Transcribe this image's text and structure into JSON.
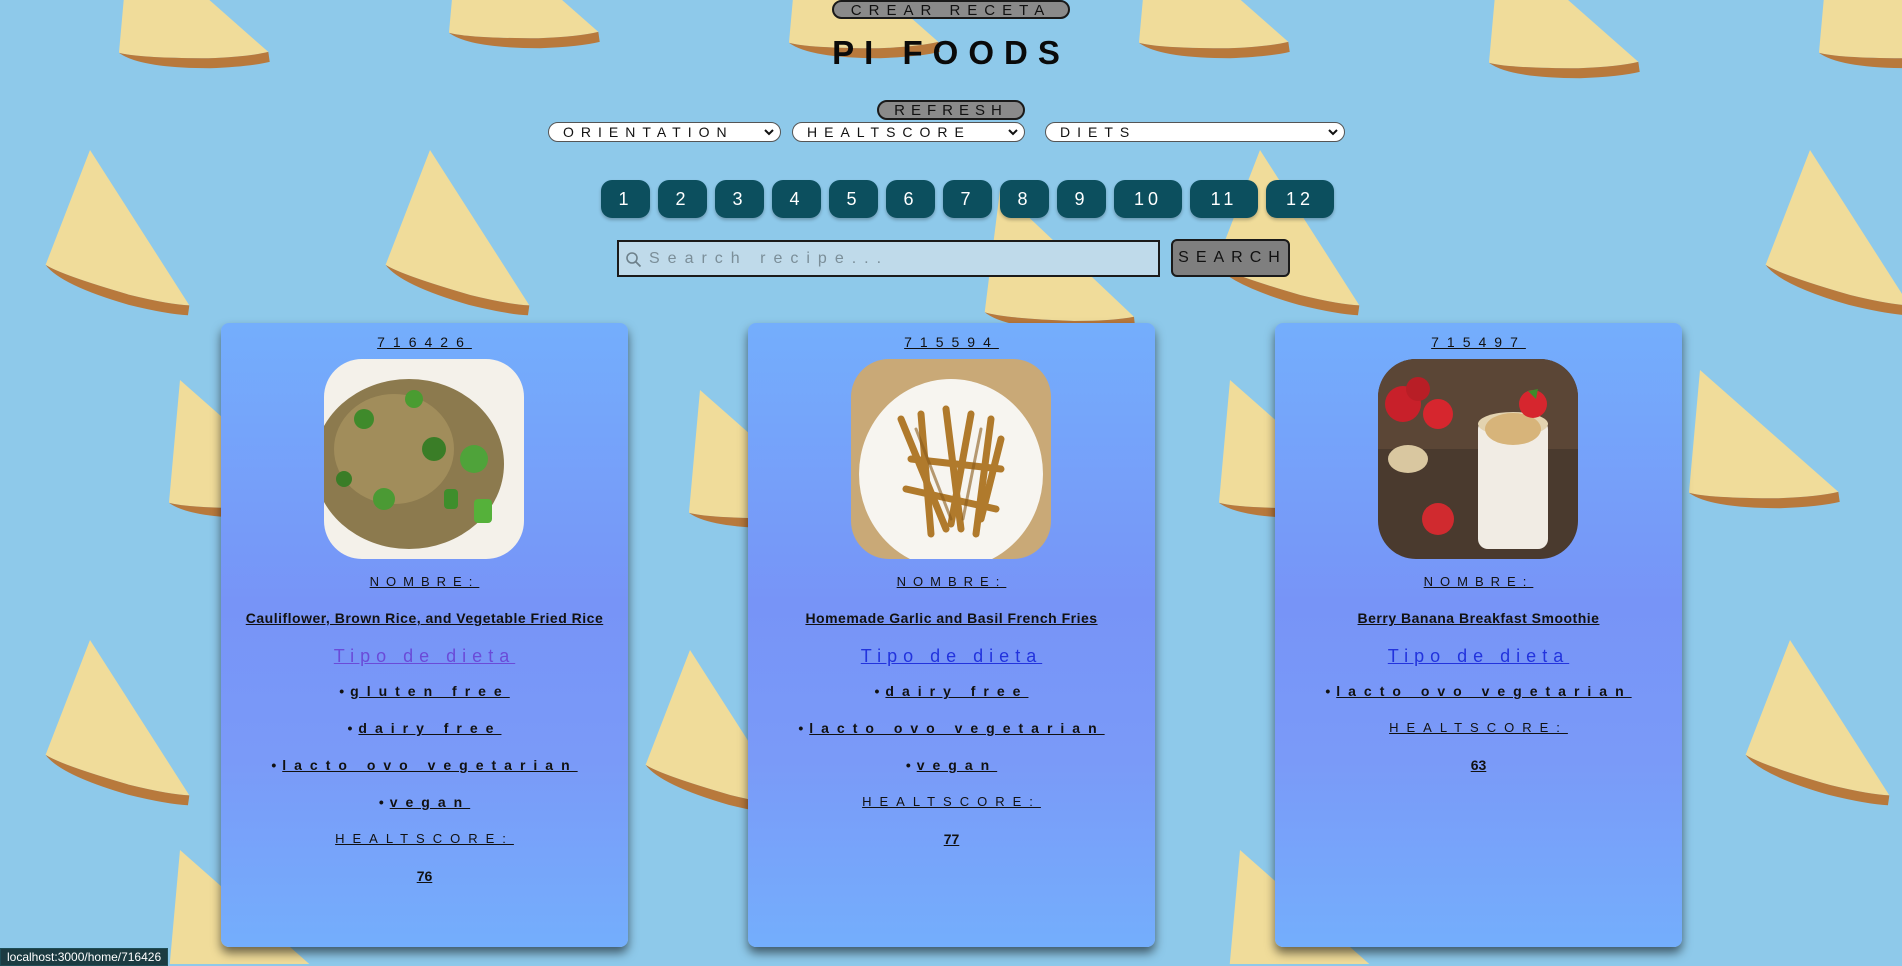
{
  "header": {
    "create_button": "CREAR RECETA",
    "title": "PI FOODS",
    "refresh_button": "REFRESH"
  },
  "filters": {
    "orientation": "ORIENTATION",
    "healthscore": "HEALTSCORE",
    "diets": "DIETS"
  },
  "pagination": [
    "1",
    "2",
    "3",
    "4",
    "5",
    "6",
    "7",
    "8",
    "9",
    "10",
    "11",
    "12"
  ],
  "search": {
    "placeholder": "Search recipe...",
    "button": "SEARCH"
  },
  "cards": [
    {
      "id": "716426",
      "name_label": "NOMBRE:",
      "name": "Cauliflower, Brown Rice, and Vegetable Fried Rice",
      "diet_title": "Tipo de dieta",
      "diets": [
        "gluten free",
        "dairy free",
        "lacto ovo vegetarian",
        "vegan"
      ],
      "healthscore_label": "HEALTSCORE:",
      "healthscore": "76"
    },
    {
      "id": "715594",
      "name_label": "NOMBRE:",
      "name": "Homemade Garlic and Basil French Fries",
      "diet_title": "Tipo de dieta",
      "diets": [
        "dairy free",
        "lacto ovo vegetarian",
        "vegan"
      ],
      "healthscore_label": "HEALTSCORE:",
      "healthscore": "77"
    },
    {
      "id": "715497",
      "name_label": "NOMBRE:",
      "name": "Berry Banana Breakfast Smoothie",
      "diet_title": "Tipo de dieta",
      "diets": [
        "lacto ovo vegetarian"
      ],
      "healthscore_label": "HEALTSCORE:",
      "healthscore": "63"
    }
  ],
  "status_bar": {
    "url": "localhost:3000/home/716426"
  },
  "colors": {
    "background": "#8ec9ea",
    "page_button": "#0c4f5e",
    "card": "#7a9af8",
    "diet_title_visited": "#6a4bd8",
    "diet_title_link": "#2233dd"
  }
}
